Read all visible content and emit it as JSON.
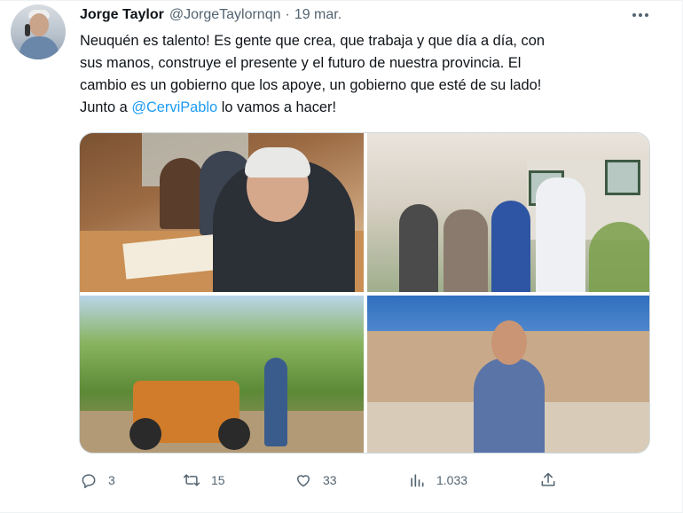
{
  "author": {
    "name": "Jorge Taylor",
    "handle": "@JorgeTaylornqn",
    "separator": "·",
    "date": "19 mar."
  },
  "tweet": {
    "lines": [
      "Neuquén es talento! Es gente que crea, que trabaja y que día a día, con",
      "sus manos, construye el presente y el futuro de nuestra provincia. El",
      "cambio es un gobierno que los apoye, un gobierno que esté de su lado!"
    ],
    "last_line_prefix": "Junto a ",
    "mention": "@CerviPablo",
    "last_line_suffix": " lo vamos a hacer!"
  },
  "media": {
    "photos": [
      "meeting-photo",
      "group-photo",
      "tractor-orchard-photo",
      "stone-house-photo"
    ]
  },
  "actions": {
    "reply_count": "3",
    "retweet_count": "15",
    "like_count": "33",
    "views_count": "1.033"
  },
  "icons": {
    "more": "more-icon",
    "reply": "reply-icon",
    "retweet": "retweet-icon",
    "like": "like-icon",
    "views": "views-icon",
    "share": "share-icon"
  },
  "colors": {
    "text": "#0f1419",
    "secondary": "#536471",
    "link": "#1d9bf0",
    "border": "#cfd9de"
  }
}
